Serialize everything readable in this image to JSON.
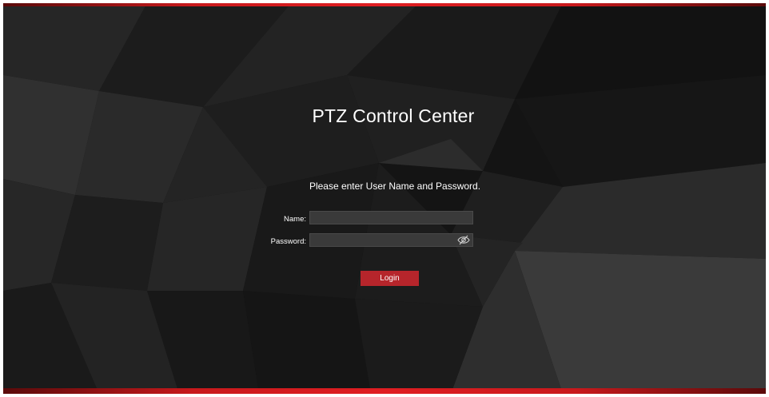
{
  "app": {
    "title": "PTZ Control Center",
    "prompt": "Please enter User Name and Password."
  },
  "form": {
    "name_label": "Name:",
    "name_value": "",
    "password_label": "Password:",
    "password_value": "",
    "login_label": "Login",
    "toggle_icon": "eye-slash-icon"
  },
  "colors": {
    "accent": "#e01e22",
    "button": "#b6252b",
    "background": "#141414",
    "field_bg": "#3a3a3a"
  }
}
